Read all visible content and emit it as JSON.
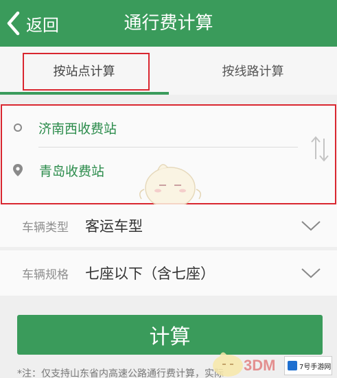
{
  "header": {
    "back_label": "返回",
    "title": "通行费计算"
  },
  "tabs": [
    {
      "label": "按站点计算",
      "active": true
    },
    {
      "label": "按线路计算",
      "active": false
    }
  ],
  "route": {
    "origin": "济南西收费站",
    "destination": "青岛收费站"
  },
  "vehicle": {
    "type_label": "车辆类型",
    "type_value": "客运车型",
    "spec_label": "车辆规格",
    "spec_value": "七座以下（含七座）"
  },
  "calculate_label": "计算",
  "note": "*注：仅支持山东省内高速公路通行费计算，实际",
  "watermark": {
    "brand": "3DM",
    "site": "7号手游网"
  },
  "colors": {
    "primary": "#3a9b5b",
    "highlight_border": "#d9262f",
    "station_text": "#2c8c4c"
  }
}
